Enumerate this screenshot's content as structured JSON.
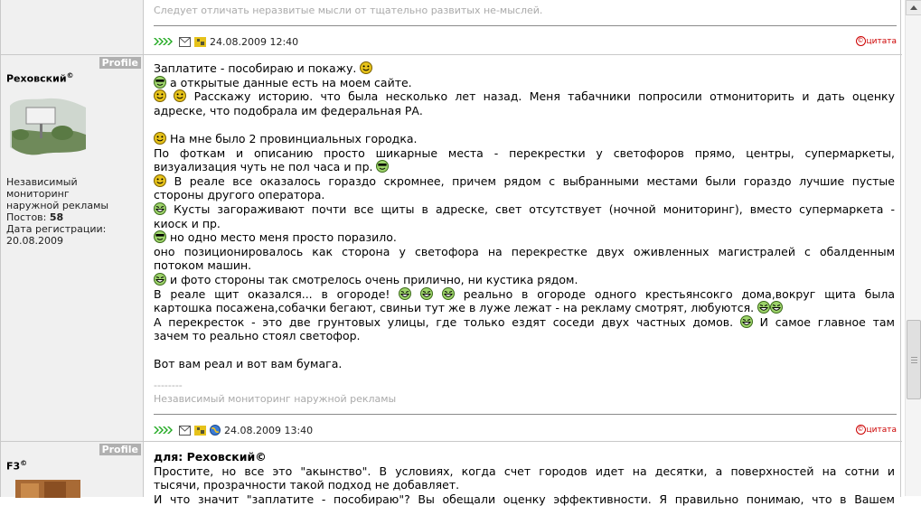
{
  "post0": {
    "signature": "Следует отличать неразвитые мысли от тщательно развитых не-мыслей.",
    "date": "24.08.2009 12:40",
    "quote_label": "цитата"
  },
  "post1": {
    "profile_label": "Profile",
    "author_name": "Реховский",
    "author_mark": "©",
    "author_title_1": "Независимый мониторинг",
    "author_title_2": "наружной рекламы",
    "posts_label": "Постов:",
    "posts_count": "58",
    "reg_label": "Дата регистрации:",
    "reg_date": "20.08.2009",
    "lines": [
      "Заплатите - пособираю и покажу.",
      "а открытые данные есть на моем сайте.",
      "Расскажу историю. что была несколько лет назад. Меня табачники попросили отмониторить и дать оценку",
      "адреске, что подобрала им федеральная РА.",
      "На мне было 2 провинциальных городка.",
      "По фоткам и описанию просто шикарные места - перекрестки у светофоров прямо, центры, супермаркеты,",
      "визуализация чуть не пол часа и пр.",
      "В реале все оказалось гораздо скромнее, причем рядом с выбранными местами были гораздо лучшие пустые",
      "стороны другого оператора.",
      "Кусты загораживают почти все щиты в адреске, свет отсутствует (ночной мониторинг), вместо супермаркета -",
      "киоск и пр.",
      "но одно место меня просто поразило.",
      "оно позиционировалось как сторона у светофора на перекрестке двух оживленных магистралей с обалденным",
      "потоком машин.",
      "и фото стороны так смотрелось очень прилично, ни кустика рядом.",
      "В реале щит оказался... в огороде!",
      "реально в огороде одного крестьянсокго дома,вокруг щита была",
      "картошка посажена,собачки бегают, свиньи тут же в луже лежат - на рекламу смотрят, любуются.",
      "А перекресток - это две грунтовых улицы, где только ездят соседи двух частных домов.",
      "И самое главное там",
      "зачем то реально стоял светофор.",
      "Вот вам реал и вот вам бумага."
    ],
    "sig_sep": "--------",
    "signature": "Независимый мониторинг наружной рекламы",
    "date": "24.08.2009 13:40",
    "quote_label": "цитата"
  },
  "post2": {
    "profile_label": "Profile",
    "author_name": "F3",
    "author_mark": "©",
    "title": "для: Реховский©",
    "lines": [
      "Простите, но все это \"акынство\". В условиях, когда счет городов идет на десятки, а поверхностей на сотни и",
      "тысячи, прозрачности такой подход не добавляет.",
      "И что значит \"заплатите - пособираю\"? Вы обещали оценку эффективности. Я правильно понимаю, что в Вашем"
    ]
  },
  "colors": {
    "author_bg": "#f0f0f0",
    "border": "#c9c9c9",
    "signature": "#aaaaaa",
    "quote": "#cc0000",
    "arrows": "#22aa22",
    "smile": "#e6c21a"
  }
}
